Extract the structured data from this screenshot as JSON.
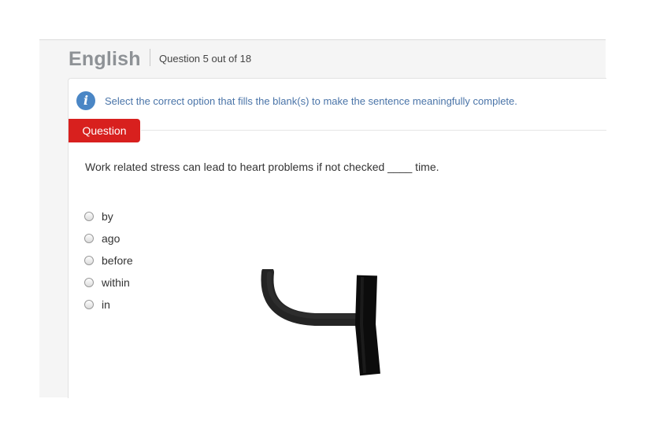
{
  "header": {
    "subject": "English",
    "question_counter": "Question 5 out of 18"
  },
  "instructions": {
    "icon": "info-icon",
    "text": "Select the correct option that fills the blank(s) to make the sentence meaningfully complete."
  },
  "question": {
    "tab_label": "Question",
    "stem": "Work related stress can lead to heart problems if not checked ____ time.",
    "options": [
      {
        "label": "by",
        "selected": false
      },
      {
        "label": "ago",
        "selected": false
      },
      {
        "label": "before",
        "selected": false
      },
      {
        "label": "within",
        "selected": false
      },
      {
        "label": "in",
        "selected": false
      }
    ]
  },
  "colors": {
    "tab_red": "#d8201e",
    "info_blue": "#4a86c5",
    "instruction_text": "#4a74a8",
    "scribble": "#111111"
  }
}
